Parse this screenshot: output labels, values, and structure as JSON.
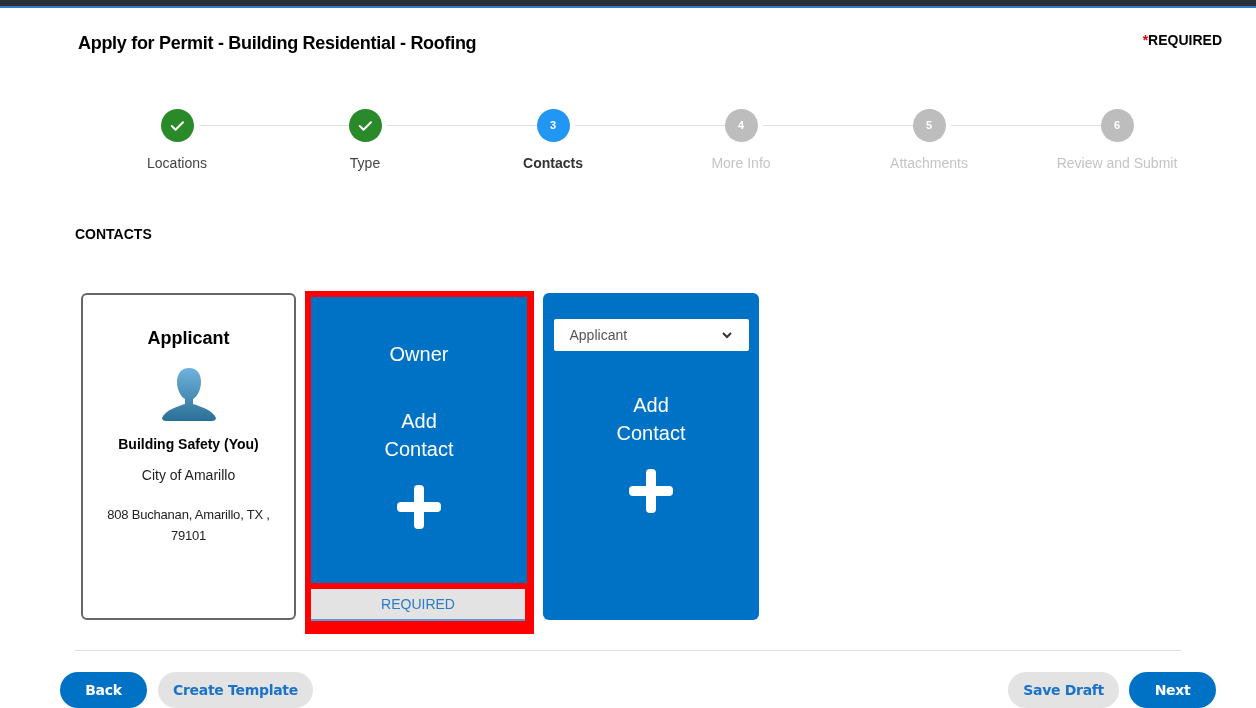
{
  "title": "Apply for Permit - Building Residential - Roofing",
  "required_note": {
    "mark": "*",
    "text": "REQUIRED"
  },
  "steps": [
    {
      "label": "Locations",
      "kind": "done"
    },
    {
      "label": "Type",
      "kind": "done"
    },
    {
      "number": "3",
      "label": "Contacts",
      "kind": "current"
    },
    {
      "number": "4",
      "label": "More Info",
      "kind": "upcoming"
    },
    {
      "number": "5",
      "label": "Attachments",
      "kind": "upcoming"
    },
    {
      "number": "6",
      "label": "Review and Submit",
      "kind": "upcoming"
    }
  ],
  "section_title": "CONTACTS",
  "cards": [
    {
      "kind": "contact",
      "role": "Applicant",
      "name": "Building Safety (You)",
      "organization": "City of Amarillo",
      "address": "808 Buchanan, Amarillo, TX , 79101"
    },
    {
      "kind": "add",
      "role": "Owner",
      "action": "Add Contact",
      "required": true,
      "required_label": "REQUIRED"
    },
    {
      "kind": "add",
      "select_value": "Applicant",
      "action": "Add Contact",
      "required": false
    }
  ],
  "buttons_left": [
    {
      "label": "Back",
      "kind": "primary"
    },
    {
      "label": "Create Template",
      "kind": "secondary"
    }
  ],
  "buttons_right": [
    {
      "label": "Save Draft",
      "kind": "secondary"
    },
    {
      "label": "Next",
      "kind": "primary"
    }
  ]
}
